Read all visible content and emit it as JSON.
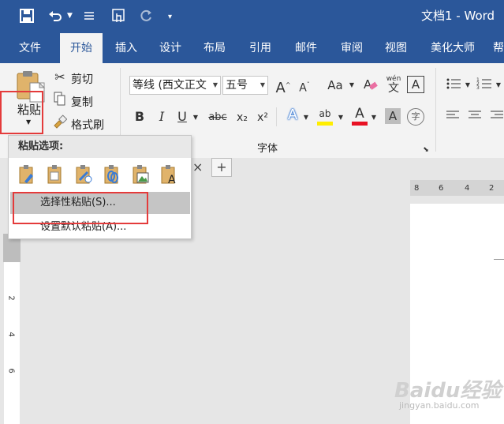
{
  "window": {
    "title": "文档1 - Word"
  },
  "qat": {
    "save_icon": "save-icon",
    "undo_icon": "undo-icon",
    "redo_icon": "redo-icon"
  },
  "tabs": [
    "文件",
    "开始",
    "插入",
    "设计",
    "布局",
    "引用",
    "邮件",
    "审阅",
    "视图",
    "美化大师",
    "帮"
  ],
  "clipboard": {
    "paste_label": "粘贴",
    "cut_label": "剪切",
    "copy_label": "复制",
    "format_painter_label": "格式刷"
  },
  "font": {
    "font_name": "等线 (西文正文",
    "font_size": "五号",
    "group_label": "字体",
    "bold": "B",
    "italic": "I",
    "underline": "U",
    "strikethrough": "abc",
    "subscript": "x₂",
    "superscript": "x²",
    "grow_font": "A",
    "change_case": "Aa",
    "phonetic": "wén",
    "char_border": "A",
    "text_effect": "A",
    "highlight": "ab",
    "font_color": "A",
    "char_shading": "A",
    "enclose": "字"
  },
  "doc_tabs": {
    "close": "×",
    "add": "+"
  },
  "ruler": {
    "top_numbers": [
      "8",
      "6",
      "4",
      "2"
    ],
    "left_numbers": [
      "2",
      "4",
      "6"
    ]
  },
  "paste_popup": {
    "header": "粘贴选项:",
    "items": [
      {
        "label": "选择性粘贴(S)..."
      },
      {
        "label": "设置默认粘贴(A)..."
      }
    ]
  },
  "watermark": {
    "brand": "Baidu经验",
    "url": "jingyan.baidu.com"
  },
  "colors": {
    "word_blue": "#2b579a",
    "highlight_red": "#e43b3b",
    "font_color_red": "#e81123",
    "highlight_yellow": "#ffee00"
  }
}
